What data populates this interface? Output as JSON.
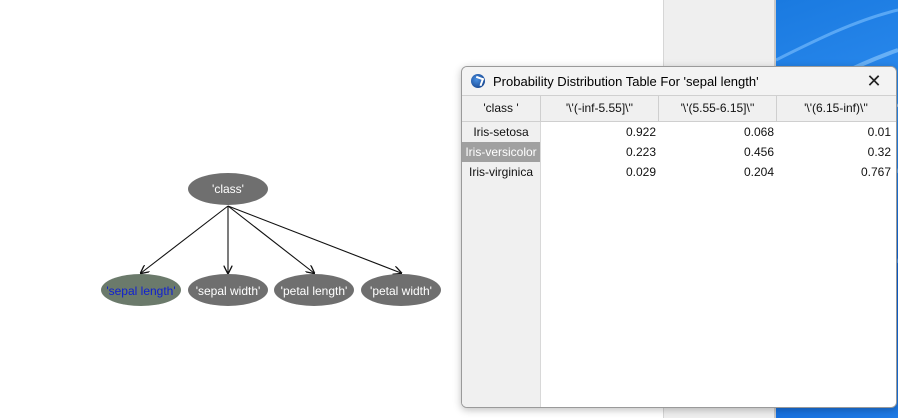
{
  "network": {
    "parent": {
      "label": "'class'"
    },
    "children": [
      {
        "label": "'sepal length'",
        "selected": true
      },
      {
        "label": "'sepal width'"
      },
      {
        "label": "'petal length'"
      },
      {
        "label": "'petal width'"
      }
    ]
  },
  "dialog": {
    "title": "Probability Distribution Table For 'sepal length'",
    "close_label": "✕",
    "corner_header": "'class '",
    "columns": [
      "'\\'(-inf-5.55]\\''",
      "'\\'(5.55-6.15]\\''",
      "'\\'(6.15-inf)\\''"
    ],
    "rows": [
      {
        "label": "Iris-setosa",
        "values": [
          "0.922",
          "0.068",
          "0.01"
        ],
        "selected": false
      },
      {
        "label": "Iris-versicolor",
        "values": [
          "0.223",
          "0.456",
          "0.32"
        ],
        "selected": true
      },
      {
        "label": "Iris-virginica",
        "values": [
          "0.029",
          "0.204",
          "0.767"
        ],
        "selected": false
      }
    ]
  },
  "colors": {
    "node_fill": "#6f6f6f",
    "selected_node_fill": "#6b7a6b",
    "selected_node_text": "#1020d0",
    "desktop_accent": "#1a7ae0"
  }
}
